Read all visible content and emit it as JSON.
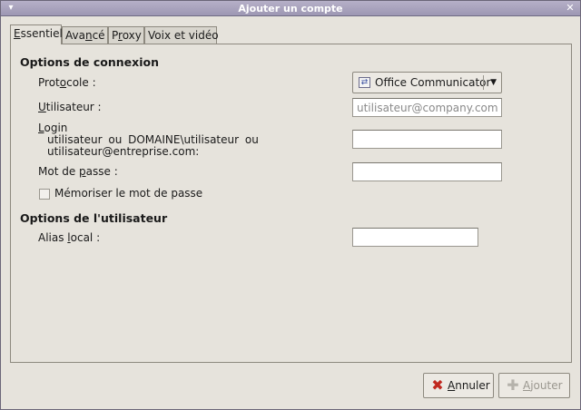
{
  "window": {
    "title": "Ajouter un compte",
    "menu_glyph": "▾",
    "close_glyph": "✕"
  },
  "tabs": [
    {
      "label_prefix": "E",
      "label_rest": "ssentiel",
      "active": true
    },
    {
      "label_prefix": "Ava",
      "u": "n",
      "label_rest": "cé",
      "active": false
    },
    {
      "label_prefix": "P",
      "u": "r",
      "label_rest": "oxy",
      "active": false
    },
    {
      "label_prefix": "Voix et vidéo",
      "active": false
    }
  ],
  "connection": {
    "section_title": "Options de connexion",
    "protocol_label_pre": "Prot",
    "protocol_label_u": "o",
    "protocol_label_post": "cole :",
    "protocol_value": "Office Communicator",
    "protocol_icon": "⇄",
    "protocol_arrow": "▼",
    "user_label_u": "U",
    "user_label_post": "tilisateur :",
    "user_placeholder": "utilisateur@company.com",
    "login_label_u": "L",
    "login_label_post": "ogin",
    "login_hint_line1": "utilisateur ou DOMAINE\\utilisateur ou",
    "login_hint_line2": "utilisateur@entreprise.com:",
    "login_value": "",
    "password_label_pre": "Mot de ",
    "password_label_u": "p",
    "password_label_post": "asse :",
    "password_value": "",
    "remember_label_pre": "M",
    "remember_label_u": "é",
    "remember_label_post": "moriser le mot de passe",
    "remember_checked": false
  },
  "user_options": {
    "section_title": "Options de l'utilisateur",
    "alias_label_pre": "Alias ",
    "alias_label_u": "l",
    "alias_label_post": "ocal :",
    "alias_value": ""
  },
  "buttons": {
    "cancel_pre": "",
    "cancel_u": "A",
    "cancel_post": "nnuler",
    "cancel_icon": "✖",
    "cancel_icon_color": "#c0281f",
    "add_pre": "",
    "add_u": "A",
    "add_post": "jouter",
    "add_icon": "✚",
    "add_icon_color": "#b5b2ab"
  }
}
